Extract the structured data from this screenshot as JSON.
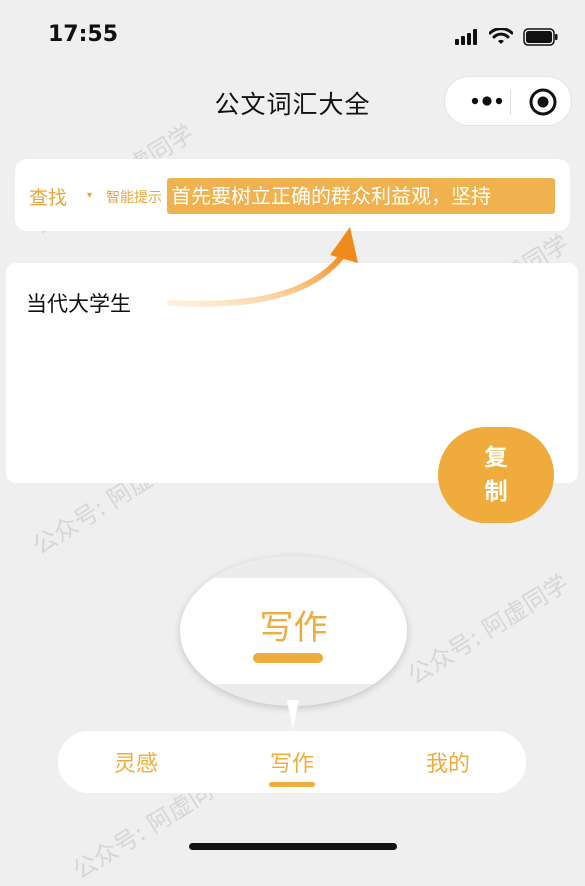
{
  "status_bar": {
    "time": "17:55",
    "icons": [
      "signal-icon",
      "wifi-icon",
      "battery-icon"
    ]
  },
  "header": {
    "title": "公文词汇大全",
    "capsule": [
      "more-icon",
      "record-icon"
    ]
  },
  "search": {
    "label": "查找",
    "arrow": "▾",
    "hint": "智能提示",
    "suggestion": "首先要树立正确的群众利益观，坚持"
  },
  "editor": {
    "text": "当代大学生"
  },
  "copy_button": {
    "line1": "复",
    "line2": "制"
  },
  "callout": {
    "label": "写作"
  },
  "tabs": [
    {
      "label": "灵感",
      "active": false
    },
    {
      "label": "写作",
      "active": true
    },
    {
      "label": "我的",
      "active": false
    }
  ],
  "watermark": "公众号: 阿虚同学",
  "colors": {
    "accent": "#efac3c",
    "background": "#efefef"
  }
}
